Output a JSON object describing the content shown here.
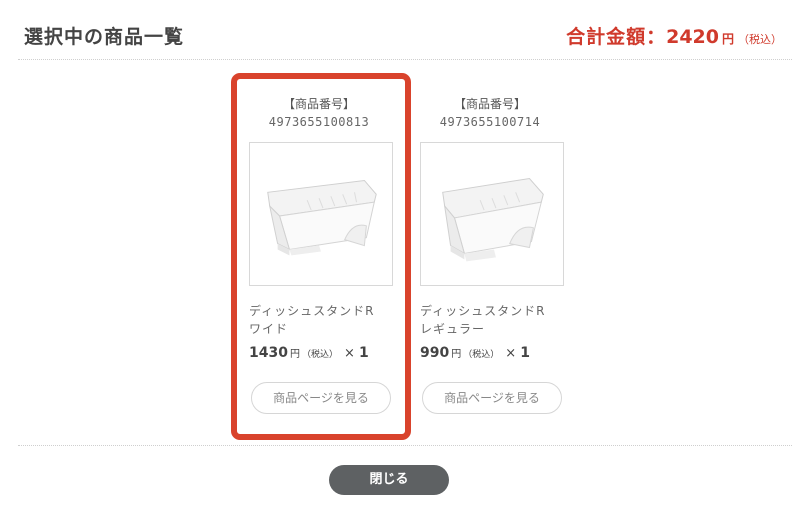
{
  "header": {
    "title": "選択中の商品一覧",
    "total_label": "合計金額：",
    "total_amount": "2420",
    "total_yen": "円",
    "total_tax": "（税込）"
  },
  "products": [
    {
      "code_label": "【商品番号】",
      "code": "4973655100813",
      "image_icon": "dish-stand-wide-image",
      "name_line1": "ディッシュスタンドR",
      "name_line2": "ワイド",
      "price": "1430",
      "yen": "円",
      "tax": "（税込）",
      "qty_prefix": "×",
      "qty": "1",
      "button_label": "商品ページを見る",
      "selected": true
    },
    {
      "code_label": "【商品番号】",
      "code": "4973655100714",
      "image_icon": "dish-stand-regular-image",
      "name_line1": "ディッシュスタンドR",
      "name_line2": "レギュラー",
      "price": "990",
      "yen": "円",
      "tax": "（税込）",
      "qty_prefix": "×",
      "qty": "1",
      "button_label": "商品ページを見る",
      "selected": false
    }
  ],
  "footer": {
    "close_label": "閉じる"
  },
  "colors": {
    "accent": "#d03a2c",
    "selection_border": "#d9432c",
    "close_button": "#5e6163"
  }
}
